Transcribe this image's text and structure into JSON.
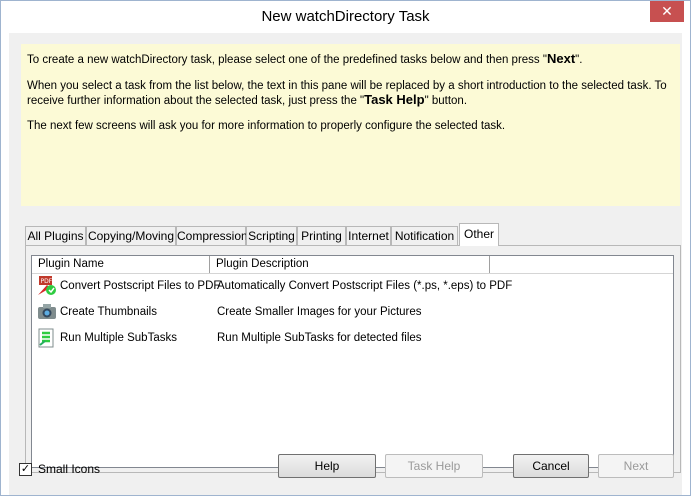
{
  "window": {
    "title": "New watchDirectory Task",
    "close_glyph": "✕"
  },
  "intro": {
    "line1_before": "To create a new watchDirectory task, please select one of the predefined tasks below and then press \"",
    "line1_bold": "Next",
    "line1_after": "\".",
    "line2_before": "When you select a task from the list below, the text in this pane will be replaced by a short introduction to the selected task. To receive further information about the selected task, just press the \"",
    "line2_bold": "Task Help",
    "line2_after": "\" button.",
    "line3": "The next few screens will ask you for more information to properly configure the selected task."
  },
  "tabs": [
    {
      "label": "All Plugins"
    },
    {
      "label": "Copying/Moving"
    },
    {
      "label": "Compression"
    },
    {
      "label": "Scripting"
    },
    {
      "label": "Printing"
    },
    {
      "label": "Internet"
    },
    {
      "label": "Notification"
    },
    {
      "label": "Other",
      "active": true
    }
  ],
  "list": {
    "columns": [
      "Plugin Name",
      "Plugin Description"
    ],
    "rows": [
      {
        "name": "Convert Postscript Files to PDF",
        "description": "Automatically Convert Postscript Files (*.ps, *.eps) to PDF",
        "icon": "pdf-convert-icon"
      },
      {
        "name": "Create Thumbnails",
        "description": "Create Smaller Images for your Pictures",
        "icon": "camera-icon"
      },
      {
        "name": "Run Multiple SubTasks",
        "description": "Run Multiple SubTasks for detected files",
        "icon": "subtasks-icon"
      }
    ]
  },
  "footer": {
    "small_icons_label": "Small Icons",
    "small_icons_checked": true,
    "help_label": "Help",
    "task_help_label": "Task Help",
    "cancel_label": "Cancel",
    "next_label": "Next"
  },
  "colors": {
    "intro_bg": "#fcfad6",
    "close_bg": "#c75050",
    "window_border": "#9fb4cf"
  }
}
